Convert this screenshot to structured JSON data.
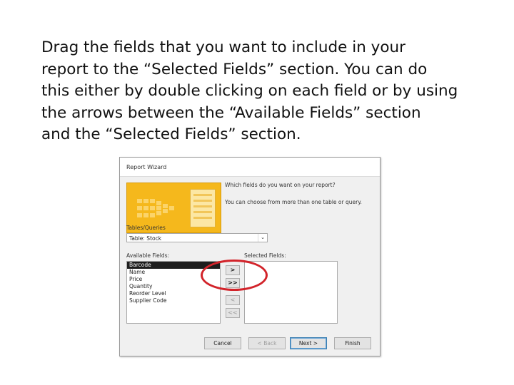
{
  "instructions": {
    "lines": [
      "Drag the fields that you want to include in your",
      "report to the “Selected Fields” section. You can do",
      "this either by double clicking on each field or by using",
      "the arrows between the “Available Fields” section",
      "and the “Selected Fields” section."
    ]
  },
  "dialog": {
    "title": "Report Wizard",
    "question": "Which fields do you want on your report?",
    "hint": "You can choose from more than one table or query.",
    "tables_label": "Tables/Queries",
    "table_selected": "Table: Stock",
    "available_label": "Available Fields:",
    "selected_label": "Selected Fields:",
    "available_fields": [
      "Barcode",
      "Name",
      "Price",
      "Quantity",
      "Reorder Level",
      "Supplier Code"
    ],
    "selected_fields": [],
    "arrow_buttons": {
      "add_one": ">",
      "add_all": ">>",
      "remove_one": "<",
      "remove_all": "<<"
    },
    "footer": {
      "cancel": "Cancel",
      "back": "< Back",
      "next": "Next >",
      "finish": "Finish"
    }
  },
  "colors": {
    "highlight_circle": "#d2232a",
    "wizard_graphic": "#f5b81c"
  }
}
